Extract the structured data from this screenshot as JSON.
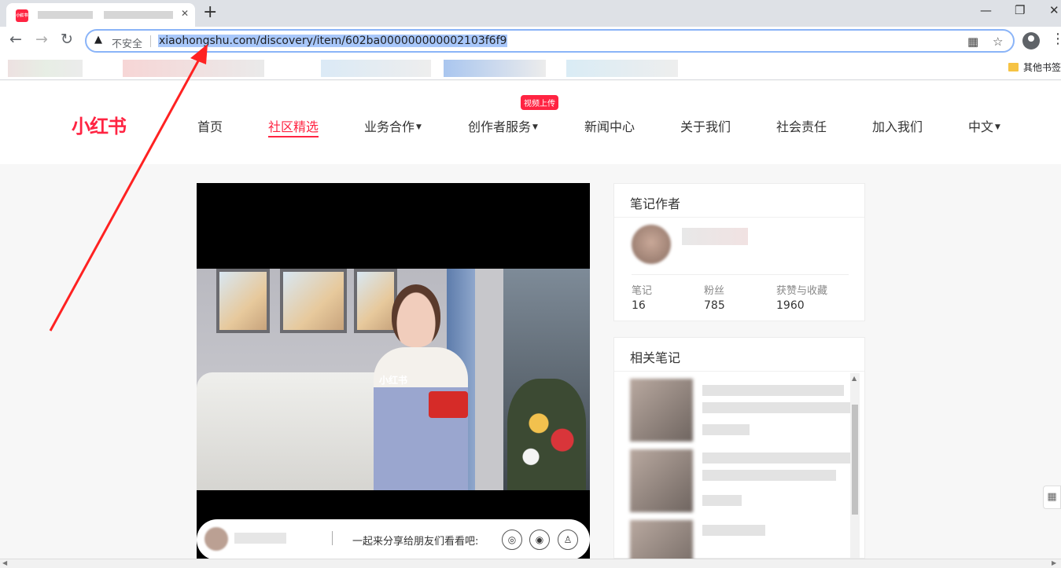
{
  "browser": {
    "favicon_text": "小红书",
    "new_tab": "+",
    "security_label": "不安全",
    "url": "xiaohongshu.com/discovery/item/602ba000000000002103f6f9",
    "other_bookmarks": "其他书签"
  },
  "site": {
    "logo": "小红书",
    "nav": [
      "首页",
      "社区精选",
      "业务合作",
      "创作者服务",
      "新闻中心",
      "关于我们",
      "社会责任",
      "加入我们",
      "中文"
    ],
    "badge": "视频上传",
    "accent": "#ff2442"
  },
  "video": {
    "watermark": "小红书",
    "share_text": "一起来分享给朋友们看看吧:"
  },
  "author_card": {
    "title": "笔记作者",
    "stats": [
      {
        "label": "笔记",
        "value": "16"
      },
      {
        "label": "粉丝",
        "value": "785"
      },
      {
        "label": "获赞与收藏",
        "value": "1960"
      }
    ]
  },
  "related_card": {
    "title": "相关笔记"
  }
}
